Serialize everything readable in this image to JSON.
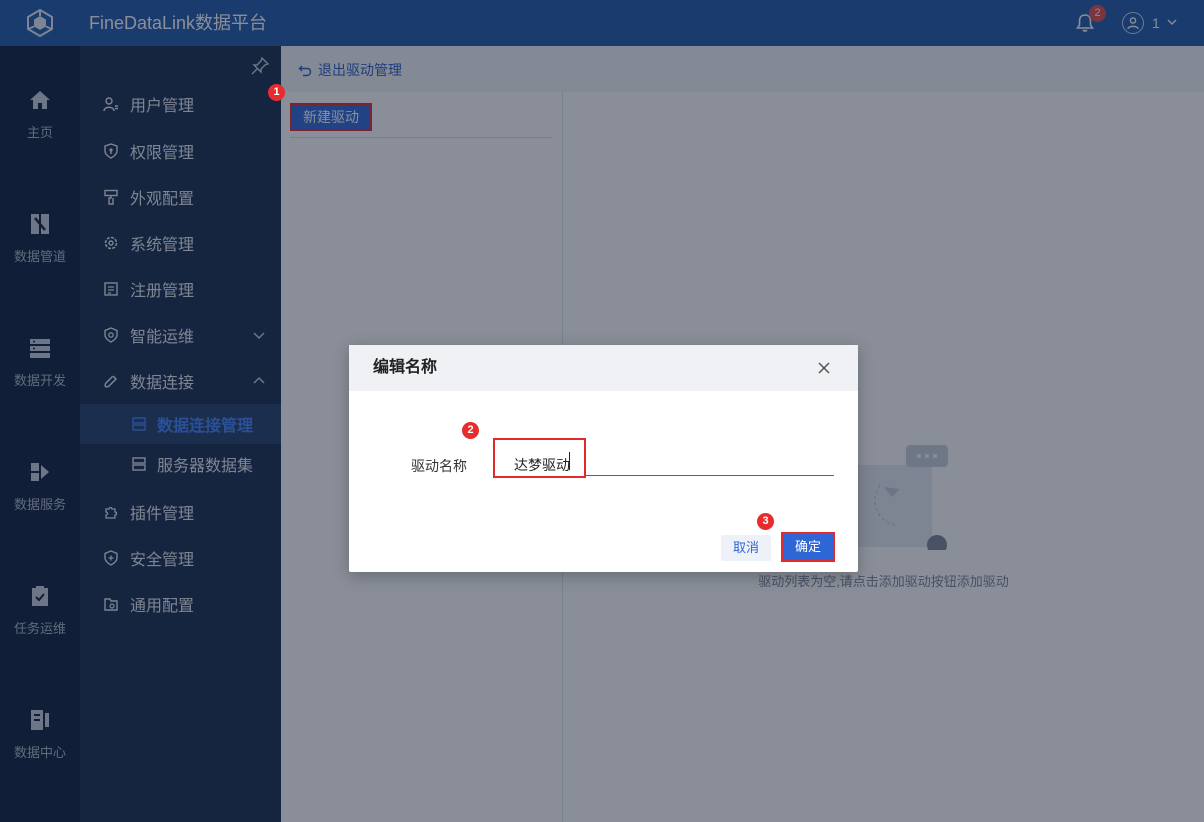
{
  "app": {
    "title": "FineDataLink数据平台",
    "notification_count": "2",
    "user_name": "1"
  },
  "rail": {
    "items": [
      {
        "label": "主页",
        "icon": "home-icon"
      },
      {
        "label": "数据管道",
        "icon": "pipeline-icon"
      },
      {
        "label": "数据开发",
        "icon": "dev-icon"
      },
      {
        "label": "数据服务",
        "icon": "service-icon"
      },
      {
        "label": "任务运维",
        "icon": "task-icon"
      },
      {
        "label": "数据中心",
        "icon": "datacenter-icon"
      }
    ]
  },
  "sidebar": {
    "items": [
      {
        "label": "用户管理",
        "icon": "user-manage-icon"
      },
      {
        "label": "权限管理",
        "icon": "permission-icon"
      },
      {
        "label": "外观配置",
        "icon": "appearance-icon"
      },
      {
        "label": "系统管理",
        "icon": "gear-icon"
      },
      {
        "label": "注册管理",
        "icon": "register-icon"
      },
      {
        "label": "智能运维",
        "icon": "ops-icon"
      },
      {
        "label": "数据连接",
        "icon": "link-icon"
      },
      {
        "label": "插件管理",
        "icon": "plugin-icon"
      },
      {
        "label": "安全管理",
        "icon": "security-icon"
      },
      {
        "label": "通用配置",
        "icon": "config-icon"
      }
    ],
    "sub_items": [
      {
        "label": "数据连接管理",
        "active": true
      },
      {
        "label": "服务器数据集",
        "active": false
      }
    ]
  },
  "main": {
    "back_label": "退出驱动管理",
    "new_driver_label": "新建驱动",
    "empty_text": "驱动列表为空,请点击添加驱动按钮添加驱动"
  },
  "dialog": {
    "title": "编辑名称",
    "field_label": "驱动名称",
    "field_value": "达梦驱动",
    "cancel_label": "取消",
    "ok_label": "确定"
  },
  "steps": [
    "1",
    "2",
    "3"
  ],
  "colors": {
    "brand": "#1e58a8",
    "primary": "#2f66d6",
    "highlight": "#e32a2a",
    "sidebar_bg": "#162a4d"
  }
}
